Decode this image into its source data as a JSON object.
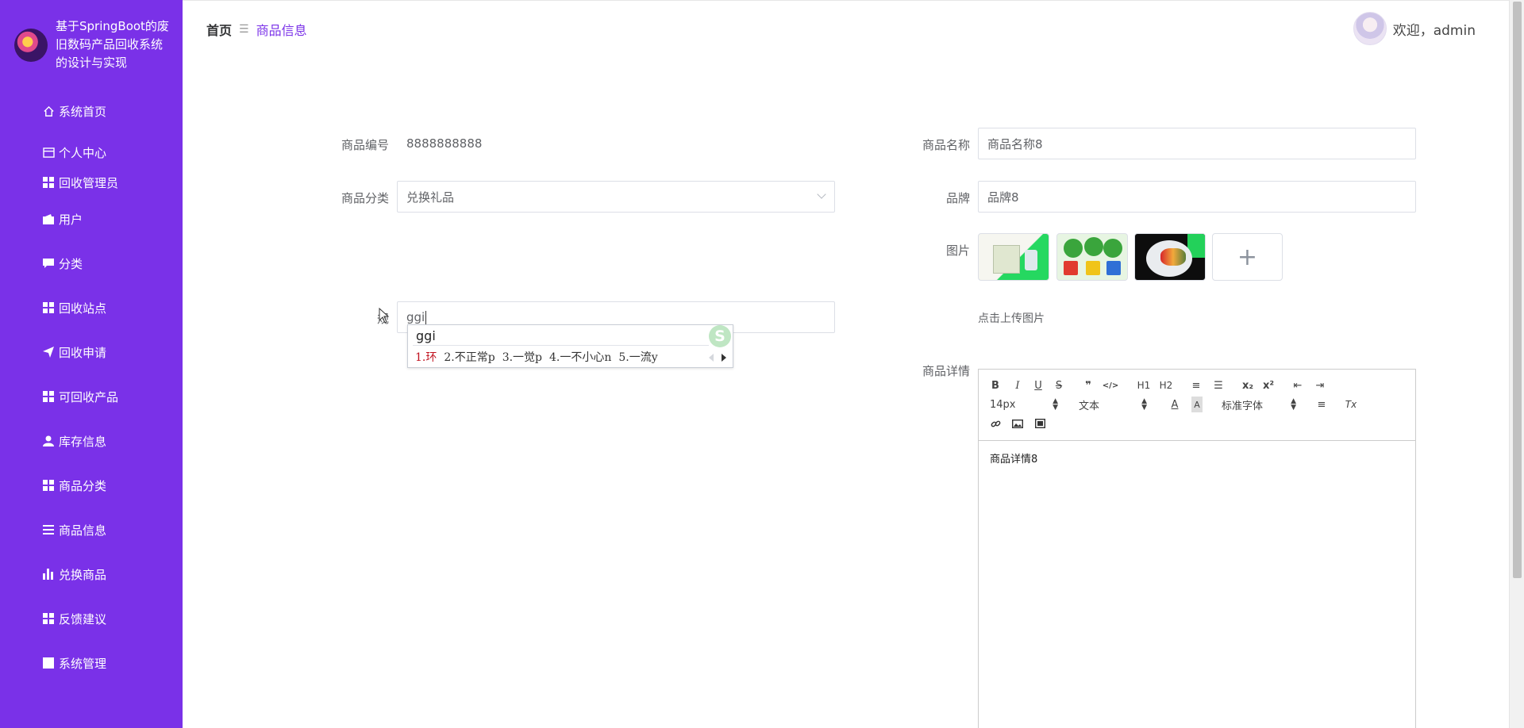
{
  "app": {
    "title": "基于SpringBoot的废旧数码产品回收系统的设计与实现"
  },
  "sidebar": {
    "items": [
      {
        "label": "系统首页",
        "icon": "home-icon"
      },
      {
        "label": "个人中心",
        "icon": "card-icon"
      },
      {
        "label": "回收管理员",
        "icon": "grid-icon"
      },
      {
        "label": "用户",
        "icon": "wallet-icon"
      },
      {
        "label": "分类",
        "icon": "comment-icon"
      },
      {
        "label": "回收站点",
        "icon": "grid-icon"
      },
      {
        "label": "回收申请",
        "icon": "paper-plane-icon"
      },
      {
        "label": "可回收产品",
        "icon": "grid-icon"
      },
      {
        "label": "库存信息",
        "icon": "person-icon"
      },
      {
        "label": "商品分类",
        "icon": "grid-icon"
      },
      {
        "label": "商品信息",
        "icon": "list-icon"
      },
      {
        "label": "兑换商品",
        "icon": "bar-chart-icon"
      },
      {
        "label": "反馈建议",
        "icon": "grid-icon"
      },
      {
        "label": "系统管理",
        "icon": "square-icon"
      }
    ]
  },
  "breadcrumb": {
    "home": "首页",
    "current": "商品信息"
  },
  "header": {
    "welcome": "欢迎，admin"
  },
  "form": {
    "code_label": "商品编号",
    "code_value": "8888888888",
    "name_label": "商品名称",
    "name_value": "商品名称8",
    "category_label": "商品分类",
    "category_value": "兑换礼品",
    "brand_label": "品牌",
    "brand_value": "品牌8",
    "image_label": "图片",
    "upload_hint": "点击上传图片",
    "spec_label": "规",
    "spec_value": "ggi",
    "detail_label": "商品详情",
    "detail_content": "商品详情8"
  },
  "ime": {
    "composition": "ggi",
    "candidates": [
      "1.环",
      "2.不正常p",
      "3.一觉p",
      "4.一不小心n",
      "5.一流y"
    ],
    "logo": "S"
  },
  "editor": {
    "font_size": "14px",
    "text_style": "文本",
    "font_family": "标准字体",
    "buttons": {
      "bold": "B",
      "italic": "I",
      "underline": "U",
      "strike": "S",
      "quote": "❞",
      "code": "</>",
      "h1": "H1",
      "h2": "H2",
      "ol": "≡",
      "ul": "☰",
      "sub": "x₂",
      "sup": "x²",
      "outdent": "⇤",
      "indent": "⇥",
      "color": "A",
      "bg": "A",
      "align": "≡",
      "clear": "Tx",
      "link": "🔗",
      "image": "▣",
      "video": "▦"
    }
  },
  "upload": {
    "plus": "+"
  },
  "colors": {
    "sidebar_bg": "#7a31e8",
    "accent": "#7a31e8"
  }
}
